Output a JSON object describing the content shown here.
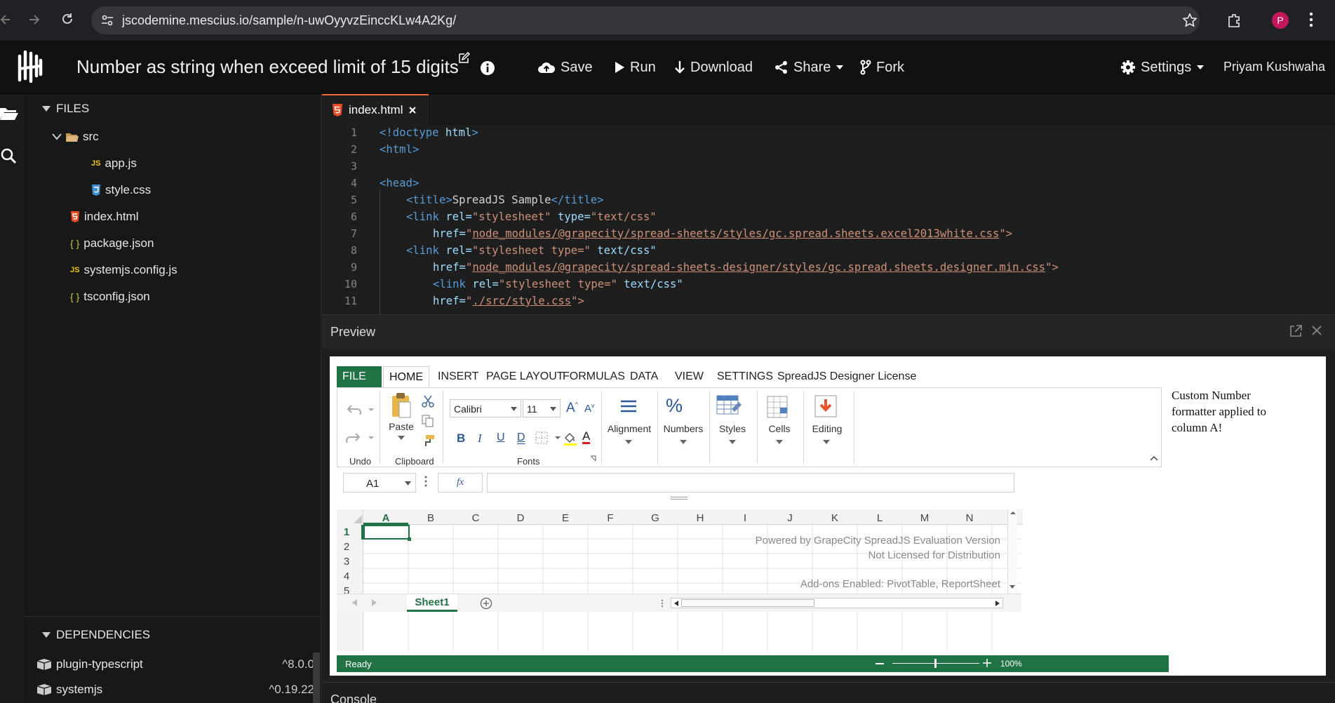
{
  "browser": {
    "url": "jscodemine.mescius.io/sample/n-uwOyyvzEinccKLw4A2Kg/",
    "profile_initial": "P",
    "colors": {
      "profile": "#c2185b"
    }
  },
  "header": {
    "title": "Number as string when exceed limit of 15 digits",
    "save": "Save",
    "run": "Run",
    "download": "Download",
    "share": "Share",
    "fork": "Fork",
    "settings": "Settings",
    "user": "Priyam Kushwaha"
  },
  "sidebar": {
    "files_label": "FILES",
    "tree": [
      {
        "name": "src",
        "type": "folder"
      },
      {
        "name": "app.js",
        "type": "js"
      },
      {
        "name": "style.css",
        "type": "css"
      },
      {
        "name": "index.html",
        "type": "html"
      },
      {
        "name": "package.json",
        "type": "json"
      },
      {
        "name": "systemjs.config.js",
        "type": "js"
      },
      {
        "name": "tsconfig.json",
        "type": "json"
      }
    ],
    "dependencies_label": "DEPENDENCIES",
    "dependencies": [
      {
        "name": "plugin-typescript",
        "version": "^8.0.0"
      },
      {
        "name": "systemjs",
        "version": "^0.19.22"
      }
    ]
  },
  "editor": {
    "tab_label": "index.html",
    "line_numbers": [
      "1",
      "2",
      "3",
      "4",
      "5",
      "6",
      "7",
      "8",
      "9",
      "10",
      "11"
    ],
    "lines": {
      "l1a": "<!doctype",
      "l1b": " html",
      "l1c": ">",
      "l2": "<html>",
      "l4": "<head>",
      "l5a": "<title>",
      "l5b": "SpreadJS Sample",
      "l5c": "</title>",
      "l6a": "<link",
      "l6b": " rel=",
      "l6c": "\"stylesheet\"",
      "l6d": " type=",
      "l6e": "\"text/css\"",
      "l7a": "href=",
      "l7b": "\"",
      "l7c": "node_modules/@grapecity/spread-sheets/styles/gc.spread.sheets.excel2013white.css",
      "l7d": "\">",
      "l8a": "<link",
      "l8b": " rel=",
      "l8c": "\"stylesheet type=\"",
      "l8d": " text/css\"",
      "l9a": "href=",
      "l9b": "\"",
      "l9c": "node_modules/@grapecity/spread-sheets-designer/styles/gc.spread.sheets.designer.min.css",
      "l9d": "\">",
      "l10a": "<link",
      "l10b": " rel=",
      "l10c": "\"stylesheet type=\"",
      "l10d": " text/css\"",
      "l11a": "href=",
      "l11b": "\"",
      "l11c": "./src/style.css",
      "l11d": "\">"
    }
  },
  "preview": {
    "title": "Preview",
    "note": "Custom Number formatter applied to column A!",
    "ribbon": {
      "tabs": [
        "FILE",
        "HOME",
        "INSERT",
        "PAGE LAYOUT",
        "FORMULAS",
        "DATA",
        "VIEW",
        "SETTINGS",
        "SpreadJS Designer License"
      ],
      "active_tab": "HOME",
      "paste": "Paste",
      "font_name": "Calibri",
      "font_size": "11",
      "alignment": "Alignment",
      "numbers": "Numbers",
      "styles": "Styles",
      "cells": "Cells",
      "editing": "Editing",
      "groups": {
        "undo": "Undo",
        "clipboard": "Clipboard",
        "fonts": "Fonts"
      },
      "font_buttons": {
        "bold": "B",
        "italic": "I",
        "underline": "U",
        "double_underline": "D",
        "font_color": "A"
      },
      "colors": {
        "file_tab": "#217346",
        "accent": "#217346"
      }
    },
    "formula_bar": {
      "name_box": "A1",
      "fx": "fx",
      "formula": ""
    },
    "columns": [
      "A",
      "B",
      "C",
      "D",
      "E",
      "F",
      "G",
      "H",
      "I",
      "J",
      "K",
      "L",
      "M",
      "N"
    ],
    "rows": [
      "1",
      "2",
      "3",
      "4",
      "5"
    ],
    "watermark": [
      "Powered by GrapeCity SpreadJS Evaluation Version",
      "Not Licensed for Distribution",
      "Add-ons Enabled: PivotTable, ReportSheet"
    ],
    "sheet_tab": "Sheet1",
    "status": "Ready",
    "zoom": "100%"
  },
  "console": {
    "title": "Console"
  }
}
